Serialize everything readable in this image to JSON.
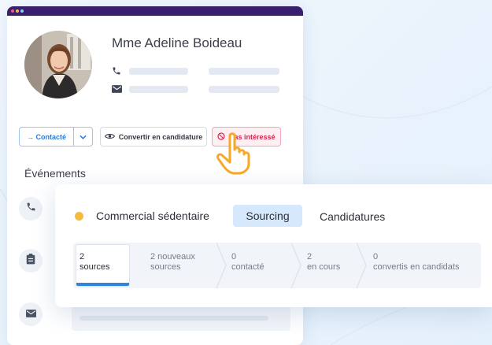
{
  "profile": {
    "name": "Mme Adeline Boideau"
  },
  "actions": {
    "contacte": "→ Contacté",
    "caret": "⌄",
    "convertir": "Convertir en candidature",
    "pas_interesse": "Pas intéressé"
  },
  "events": {
    "title": "Événements"
  },
  "job": {
    "title": "Commercial sédentaire",
    "status_color": "#f7bb3c",
    "tabs": {
      "sourcing": "Sourcing",
      "candidatures": "Candidatures"
    }
  },
  "pipeline": {
    "stages": [
      {
        "count": "2",
        "label": "sources"
      },
      {
        "count": "2 nouveaux",
        "label": "sources"
      },
      {
        "count": "0",
        "label": "contacté"
      },
      {
        "count": "2",
        "label": "en cours"
      },
      {
        "count": "0",
        "label": "convertis en candidats"
      }
    ]
  },
  "colors": {
    "accent": "#2f84e0",
    "danger": "#d4284f",
    "titlebar": "#3a1f6e"
  },
  "icons": {
    "phone": "phone-icon",
    "mail": "mail-icon",
    "eye": "eye-icon",
    "ban": "ban-icon",
    "clipboard": "clipboard-icon",
    "hand": "pointer-hand-icon"
  }
}
